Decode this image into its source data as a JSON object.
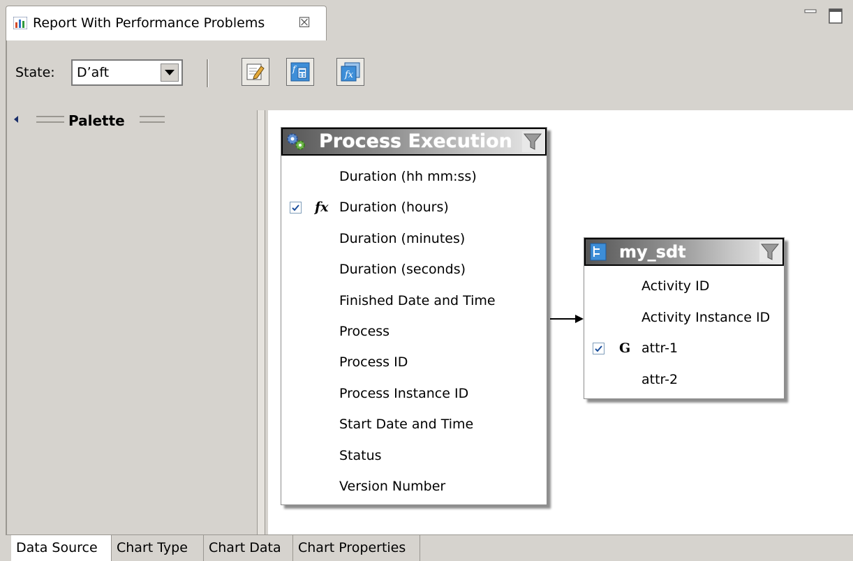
{
  "editor_tab": {
    "title": "Report With Performance Problems",
    "close_glyph": "☒",
    "icon": "report-chart-icon"
  },
  "window_controls": {
    "minimize": "minimize-icon",
    "maximize": "maximize-icon"
  },
  "toolbar": {
    "state_label": "State:",
    "state_value": "Dʼaft",
    "buttons": [
      "edit-icon",
      "formula-icon",
      "calculated-field-icon"
    ]
  },
  "palette": {
    "label": "Palette"
  },
  "process_table": {
    "title": "Process Execution",
    "icon": "gears-icon",
    "filter_icon": "filter-icon",
    "rows": [
      {
        "label": "Duration (hh mm:ss)",
        "checked": false,
        "marker": ""
      },
      {
        "label": "Duration (hours)",
        "checked": true,
        "marker": "fx"
      },
      {
        "label": "Duration (minutes)",
        "checked": false,
        "marker": ""
      },
      {
        "label": "Duration (seconds)",
        "checked": false,
        "marker": ""
      },
      {
        "label": "Finished Date and Time",
        "checked": false,
        "marker": ""
      },
      {
        "label": "Process",
        "checked": false,
        "marker": ""
      },
      {
        "label": "Process ID",
        "checked": false,
        "marker": ""
      },
      {
        "label": "Process Instance ID",
        "checked": false,
        "marker": ""
      },
      {
        "label": "Start Date and Time",
        "checked": false,
        "marker": ""
      },
      {
        "label": "Status",
        "checked": false,
        "marker": ""
      },
      {
        "label": "Version Number",
        "checked": false,
        "marker": ""
      }
    ]
  },
  "sdt_table": {
    "title": "my_sdt",
    "icon": "data-structure-icon",
    "filter_icon": "filter-icon",
    "rows": [
      {
        "label": "Activity ID",
        "checked": false,
        "marker": ""
      },
      {
        "label": "Activity Instance ID",
        "checked": false,
        "marker": ""
      },
      {
        "label": "attr-1",
        "checked": true,
        "marker": "G"
      },
      {
        "label": "attr-2",
        "checked": false,
        "marker": ""
      }
    ]
  },
  "bottom_tabs": [
    {
      "label": "Data Source",
      "active": true
    },
    {
      "label": "Chart Type",
      "active": false
    },
    {
      "label": "Chart Data",
      "active": false
    },
    {
      "label": "Chart Properties",
      "active": false
    }
  ],
  "colors": {
    "background": "#d6d3ce",
    "canvas": "#ffffff",
    "check": "#1c4f9c"
  }
}
